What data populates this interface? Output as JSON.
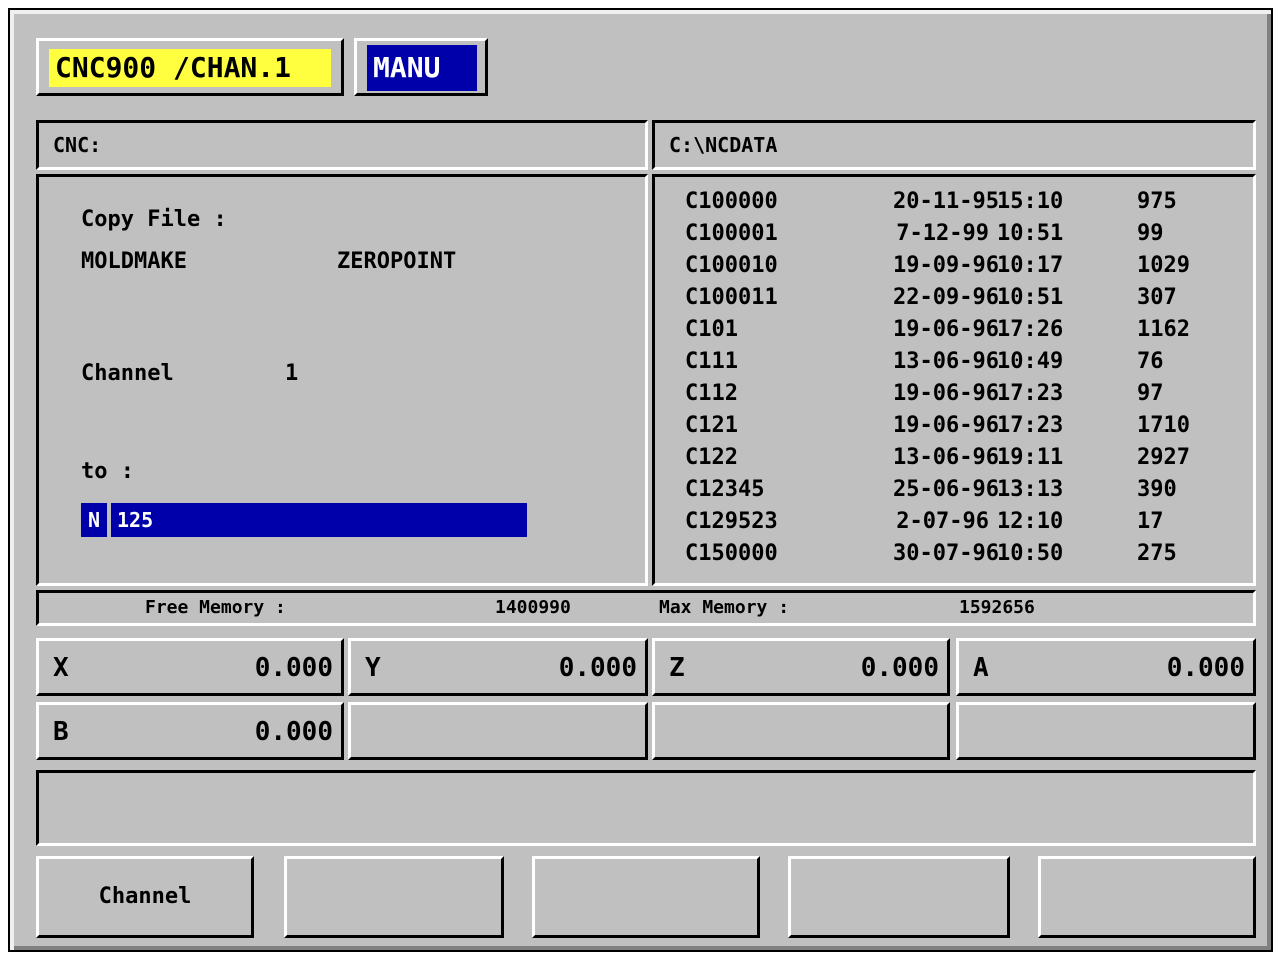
{
  "header": {
    "title": "CNC900 /CHAN.1",
    "mode": "MANU"
  },
  "left_panel": {
    "header": "CNC:",
    "copy_file_label": "Copy File :",
    "filenames": [
      "MOLDMAKE",
      "ZEROPOINT"
    ],
    "channel_label": "Channel",
    "channel_value": "1",
    "to_label": "to :",
    "n_prefix": "N",
    "n_value": "125"
  },
  "right_panel": {
    "header": "C:\\NCDATA",
    "files": [
      {
        "name": "C100000",
        "date": "20-11-95",
        "time": "15:10",
        "size": "975"
      },
      {
        "name": "C100001",
        "date": "7-12-99",
        "time": "10:51",
        "size": "99"
      },
      {
        "name": "C100010",
        "date": "19-09-96",
        "time": "10:17",
        "size": "1029"
      },
      {
        "name": "C100011",
        "date": "22-09-96",
        "time": "10:51",
        "size": "307"
      },
      {
        "name": "C101",
        "date": "19-06-96",
        "time": "17:26",
        "size": "1162"
      },
      {
        "name": "C111",
        "date": "13-06-96",
        "time": "10:49",
        "size": "76"
      },
      {
        "name": "C112",
        "date": "19-06-96",
        "time": "17:23",
        "size": "97"
      },
      {
        "name": "C121",
        "date": "19-06-96",
        "time": "17:23",
        "size": "1710"
      },
      {
        "name": "C122",
        "date": "13-06-96",
        "time": "19:11",
        "size": "2927"
      },
      {
        "name": "C12345",
        "date": "25-06-96",
        "time": "13:13",
        "size": "390"
      },
      {
        "name": "C129523",
        "date": "2-07-96",
        "time": "12:10",
        "size": "17"
      },
      {
        "name": "C150000",
        "date": "30-07-96",
        "time": "10:50",
        "size": "275"
      }
    ]
  },
  "memory": {
    "free_label": "Free Memory :",
    "free_value": "1400990",
    "max_label": "Max Memory :",
    "max_value": "1592656"
  },
  "axes": [
    {
      "name": "X",
      "value": "0.000"
    },
    {
      "name": "Y",
      "value": "0.000"
    },
    {
      "name": "Z",
      "value": "0.000"
    },
    {
      "name": "A",
      "value": "0.000"
    },
    {
      "name": "B",
      "value": "0.000"
    }
  ],
  "softkeys": [
    "Channel",
    "",
    "",
    "",
    ""
  ]
}
